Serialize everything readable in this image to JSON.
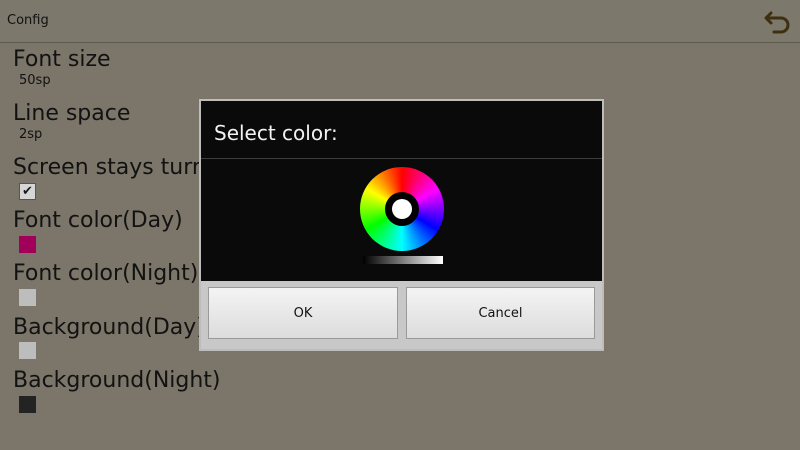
{
  "topbar": {
    "title": "Config"
  },
  "settings": [
    {
      "label": "Font size",
      "value": "50sp"
    },
    {
      "label": "Line space",
      "value": "2sp"
    },
    {
      "label": "Screen stays turn on",
      "checked": true
    },
    {
      "label": "Font color(Day)",
      "color": "#a0005a"
    },
    {
      "label": "Font color(Night)",
      "color": "#bdbdbd"
    },
    {
      "label": "Background(Day)",
      "color": "#bdbdbd"
    },
    {
      "label": "Background(Night)",
      "color": "#232323"
    }
  ],
  "dialog": {
    "title": "Select color:",
    "ok_label": "OK",
    "cancel_label": "Cancel"
  },
  "colors": {
    "background": "#7b7669",
    "dialog": "#0a0a0a",
    "back_icon": "#4a3a14"
  },
  "icons": {
    "back": "back-arrow-icon",
    "check": "checkmark-icon"
  }
}
